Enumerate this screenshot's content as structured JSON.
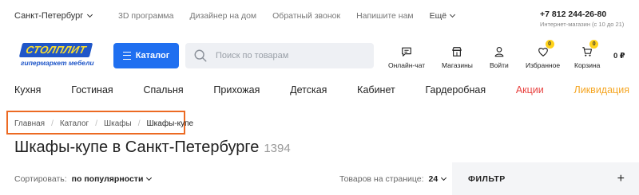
{
  "top": {
    "city": "Санкт-Петербург",
    "links": [
      "3D программа",
      "Дизайнер на дом",
      "Обратный звонок",
      "Напишите нам"
    ],
    "more": "Ещё",
    "phone": "+7 812 244-26-80",
    "phone_note": "Интернет-магазин (с 10 до 21)"
  },
  "logo": {
    "name": "СТОЛПЛИТ",
    "tagline": "гипермаркет мебели"
  },
  "catalog_button": "Каталог",
  "search": {
    "placeholder": "Поиск по товарам"
  },
  "actions": {
    "chat": "Онлайн-чат",
    "stores": "Магазины",
    "login": "Войти",
    "favorites": "Избранное",
    "favorites_count": "0",
    "cart": "Корзина",
    "cart_count": "0",
    "cart_total": "0 ₽"
  },
  "categories": [
    "Кухня",
    "Гостиная",
    "Спальня",
    "Прихожая",
    "Детская",
    "Кабинет",
    "Гардеробная",
    "Акции",
    "Ликвидация"
  ],
  "breadcrumbs": [
    "Главная",
    "Каталог",
    "Шкафы",
    "Шкафы-купе"
  ],
  "breadcrumb_sep": "/",
  "page": {
    "title": "Шкафы-купе в Санкт-Петербурге",
    "count": "1394"
  },
  "sort": {
    "label": "Сортировать:",
    "value": "по популярности"
  },
  "per_page": {
    "label": "Товаров на странице:",
    "value": "24"
  },
  "filter": {
    "label": "ФИЛЬТР",
    "toggle": "+"
  },
  "colors": {
    "accent": "#1f6ff0",
    "brand": "#1f56c8",
    "sale": "#e8413e",
    "liquidation": "#f5a623",
    "highlight": "#ec6a23",
    "badge": "#ffd21a"
  }
}
